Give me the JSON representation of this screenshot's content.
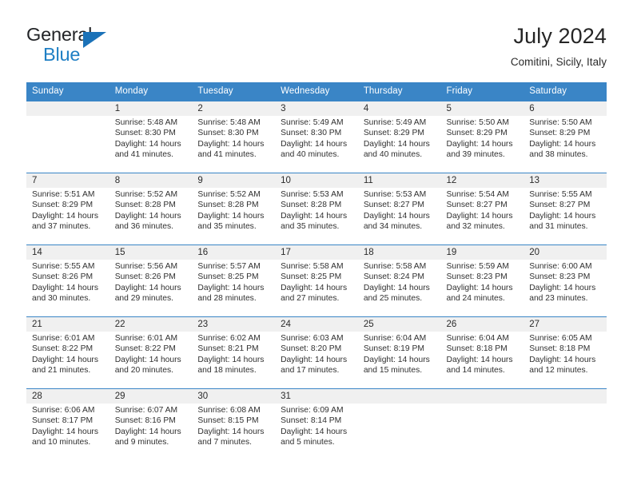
{
  "brand": {
    "name_part1": "General",
    "name_part2": "Blue",
    "logo_icon": "blue-triangle-flag-icon",
    "accent_color": "#1b72b8"
  },
  "header": {
    "title": "July 2024",
    "subtitle": "Comitini, Sicily, Italy"
  },
  "calendar": {
    "header_bg": "#3a85c6",
    "row_band_bg": "#f0f0f0",
    "weekday_headers": [
      "Sunday",
      "Monday",
      "Tuesday",
      "Wednesday",
      "Thursday",
      "Friday",
      "Saturday"
    ],
    "labels": {
      "sunrise": "Sunrise:",
      "sunset": "Sunset:",
      "daylight": "Daylight:"
    },
    "weeks": [
      [
        {
          "day": "",
          "blank": true
        },
        {
          "day": "1",
          "sunrise": "Sunrise: 5:48 AM",
          "sunset": "Sunset: 8:30 PM",
          "daylight_l1": "Daylight: 14 hours",
          "daylight_l2": "and 41 minutes."
        },
        {
          "day": "2",
          "sunrise": "Sunrise: 5:48 AM",
          "sunset": "Sunset: 8:30 PM",
          "daylight_l1": "Daylight: 14 hours",
          "daylight_l2": "and 41 minutes."
        },
        {
          "day": "3",
          "sunrise": "Sunrise: 5:49 AM",
          "sunset": "Sunset: 8:30 PM",
          "daylight_l1": "Daylight: 14 hours",
          "daylight_l2": "and 40 minutes."
        },
        {
          "day": "4",
          "sunrise": "Sunrise: 5:49 AM",
          "sunset": "Sunset: 8:29 PM",
          "daylight_l1": "Daylight: 14 hours",
          "daylight_l2": "and 40 minutes."
        },
        {
          "day": "5",
          "sunrise": "Sunrise: 5:50 AM",
          "sunset": "Sunset: 8:29 PM",
          "daylight_l1": "Daylight: 14 hours",
          "daylight_l2": "and 39 minutes."
        },
        {
          "day": "6",
          "sunrise": "Sunrise: 5:50 AM",
          "sunset": "Sunset: 8:29 PM",
          "daylight_l1": "Daylight: 14 hours",
          "daylight_l2": "and 38 minutes."
        }
      ],
      [
        {
          "day": "7",
          "sunrise": "Sunrise: 5:51 AM",
          "sunset": "Sunset: 8:29 PM",
          "daylight_l1": "Daylight: 14 hours",
          "daylight_l2": "and 37 minutes."
        },
        {
          "day": "8",
          "sunrise": "Sunrise: 5:52 AM",
          "sunset": "Sunset: 8:28 PM",
          "daylight_l1": "Daylight: 14 hours",
          "daylight_l2": "and 36 minutes."
        },
        {
          "day": "9",
          "sunrise": "Sunrise: 5:52 AM",
          "sunset": "Sunset: 8:28 PM",
          "daylight_l1": "Daylight: 14 hours",
          "daylight_l2": "and 35 minutes."
        },
        {
          "day": "10",
          "sunrise": "Sunrise: 5:53 AM",
          "sunset": "Sunset: 8:28 PM",
          "daylight_l1": "Daylight: 14 hours",
          "daylight_l2": "and 35 minutes."
        },
        {
          "day": "11",
          "sunrise": "Sunrise: 5:53 AM",
          "sunset": "Sunset: 8:27 PM",
          "daylight_l1": "Daylight: 14 hours",
          "daylight_l2": "and 34 minutes."
        },
        {
          "day": "12",
          "sunrise": "Sunrise: 5:54 AM",
          "sunset": "Sunset: 8:27 PM",
          "daylight_l1": "Daylight: 14 hours",
          "daylight_l2": "and 32 minutes."
        },
        {
          "day": "13",
          "sunrise": "Sunrise: 5:55 AM",
          "sunset": "Sunset: 8:27 PM",
          "daylight_l1": "Daylight: 14 hours",
          "daylight_l2": "and 31 minutes."
        }
      ],
      [
        {
          "day": "14",
          "sunrise": "Sunrise: 5:55 AM",
          "sunset": "Sunset: 8:26 PM",
          "daylight_l1": "Daylight: 14 hours",
          "daylight_l2": "and 30 minutes."
        },
        {
          "day": "15",
          "sunrise": "Sunrise: 5:56 AM",
          "sunset": "Sunset: 8:26 PM",
          "daylight_l1": "Daylight: 14 hours",
          "daylight_l2": "and 29 minutes."
        },
        {
          "day": "16",
          "sunrise": "Sunrise: 5:57 AM",
          "sunset": "Sunset: 8:25 PM",
          "daylight_l1": "Daylight: 14 hours",
          "daylight_l2": "and 28 minutes."
        },
        {
          "day": "17",
          "sunrise": "Sunrise: 5:58 AM",
          "sunset": "Sunset: 8:25 PM",
          "daylight_l1": "Daylight: 14 hours",
          "daylight_l2": "and 27 minutes."
        },
        {
          "day": "18",
          "sunrise": "Sunrise: 5:58 AM",
          "sunset": "Sunset: 8:24 PM",
          "daylight_l1": "Daylight: 14 hours",
          "daylight_l2": "and 25 minutes."
        },
        {
          "day": "19",
          "sunrise": "Sunrise: 5:59 AM",
          "sunset": "Sunset: 8:23 PM",
          "daylight_l1": "Daylight: 14 hours",
          "daylight_l2": "and 24 minutes."
        },
        {
          "day": "20",
          "sunrise": "Sunrise: 6:00 AM",
          "sunset": "Sunset: 8:23 PM",
          "daylight_l1": "Daylight: 14 hours",
          "daylight_l2": "and 23 minutes."
        }
      ],
      [
        {
          "day": "21",
          "sunrise": "Sunrise: 6:01 AM",
          "sunset": "Sunset: 8:22 PM",
          "daylight_l1": "Daylight: 14 hours",
          "daylight_l2": "and 21 minutes."
        },
        {
          "day": "22",
          "sunrise": "Sunrise: 6:01 AM",
          "sunset": "Sunset: 8:22 PM",
          "daylight_l1": "Daylight: 14 hours",
          "daylight_l2": "and 20 minutes."
        },
        {
          "day": "23",
          "sunrise": "Sunrise: 6:02 AM",
          "sunset": "Sunset: 8:21 PM",
          "daylight_l1": "Daylight: 14 hours",
          "daylight_l2": "and 18 minutes."
        },
        {
          "day": "24",
          "sunrise": "Sunrise: 6:03 AM",
          "sunset": "Sunset: 8:20 PM",
          "daylight_l1": "Daylight: 14 hours",
          "daylight_l2": "and 17 minutes."
        },
        {
          "day": "25",
          "sunrise": "Sunrise: 6:04 AM",
          "sunset": "Sunset: 8:19 PM",
          "daylight_l1": "Daylight: 14 hours",
          "daylight_l2": "and 15 minutes."
        },
        {
          "day": "26",
          "sunrise": "Sunrise: 6:04 AM",
          "sunset": "Sunset: 8:18 PM",
          "daylight_l1": "Daylight: 14 hours",
          "daylight_l2": "and 14 minutes."
        },
        {
          "day": "27",
          "sunrise": "Sunrise: 6:05 AM",
          "sunset": "Sunset: 8:18 PM",
          "daylight_l1": "Daylight: 14 hours",
          "daylight_l2": "and 12 minutes."
        }
      ],
      [
        {
          "day": "28",
          "sunrise": "Sunrise: 6:06 AM",
          "sunset": "Sunset: 8:17 PM",
          "daylight_l1": "Daylight: 14 hours",
          "daylight_l2": "and 10 minutes."
        },
        {
          "day": "29",
          "sunrise": "Sunrise: 6:07 AM",
          "sunset": "Sunset: 8:16 PM",
          "daylight_l1": "Daylight: 14 hours",
          "daylight_l2": "and 9 minutes."
        },
        {
          "day": "30",
          "sunrise": "Sunrise: 6:08 AM",
          "sunset": "Sunset: 8:15 PM",
          "daylight_l1": "Daylight: 14 hours",
          "daylight_l2": "and 7 minutes."
        },
        {
          "day": "31",
          "sunrise": "Sunrise: 6:09 AM",
          "sunset": "Sunset: 8:14 PM",
          "daylight_l1": "Daylight: 14 hours",
          "daylight_l2": "and 5 minutes."
        },
        {
          "day": "",
          "blank": true
        },
        {
          "day": "",
          "blank": true
        },
        {
          "day": "",
          "blank": true
        }
      ]
    ]
  }
}
